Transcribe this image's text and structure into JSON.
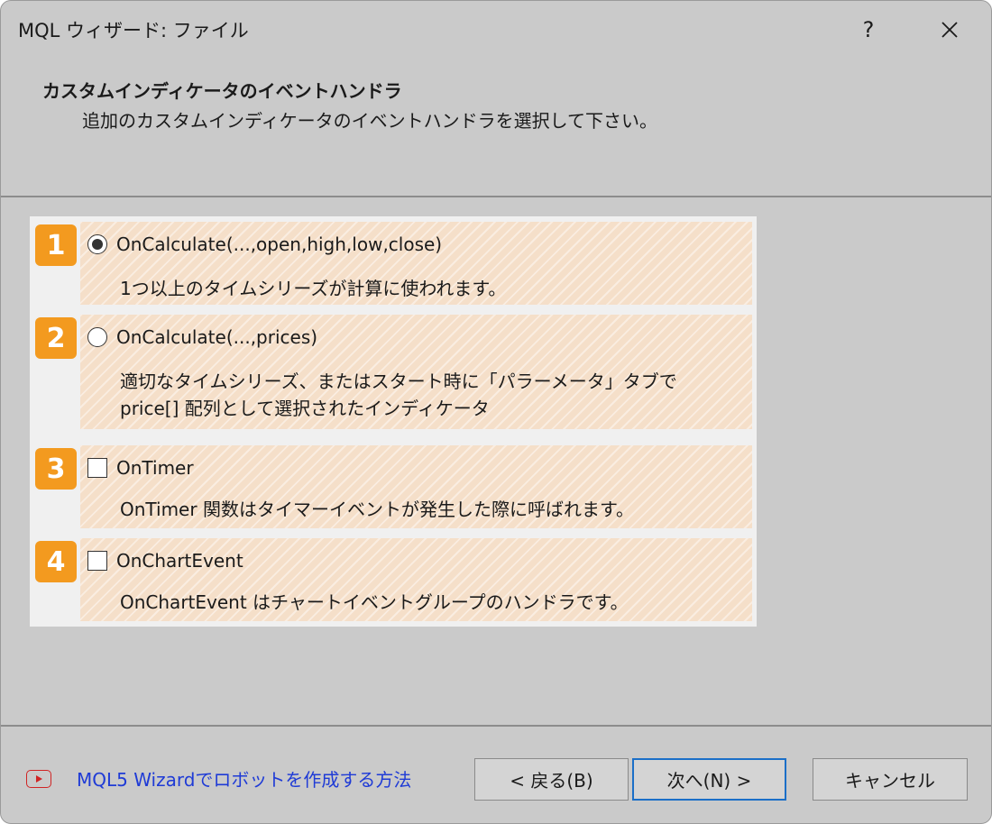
{
  "window": {
    "title": "MQL ウィザード: ファイル",
    "help_label": "?",
    "close_label": "✕"
  },
  "header": {
    "title": "カスタムインディケータのイベントハンドラ",
    "subtitle": "追加のカスタムインディケータのイベントハンドラを選択して下さい。"
  },
  "options": [
    {
      "badge": "1",
      "control": "radio",
      "checked": true,
      "label": "OnCalculate(...,open,high,low,close)",
      "desc": [
        "1つ以上のタイムシリーズが計算に使われます。"
      ]
    },
    {
      "badge": "2",
      "control": "radio",
      "checked": false,
      "label": "OnCalculate(...,prices)",
      "desc": [
        "適切なタイムシリーズ、またはスタート時に「パラーメータ」タブで",
        "price[] 配列として選択されたインディケータ"
      ]
    },
    {
      "badge": "3",
      "control": "checkbox",
      "checked": false,
      "label": "OnTimer",
      "desc": [
        "OnTimer 関数はタイマーイベントが発生した際に呼ばれます。"
      ]
    },
    {
      "badge": "4",
      "control": "checkbox",
      "checked": false,
      "label": "OnChartEvent",
      "desc": [
        "OnChartEvent はチャートイベントグループのハンドラです。"
      ]
    }
  ],
  "footer": {
    "link_icon": "video-play-icon",
    "link_text": "MQL5 Wizardでロボットを作成する方法",
    "back_label": "< 戻る(B)",
    "next_label": "次へ(N) >",
    "cancel_label": "キャンセル"
  },
  "colors": {
    "badge": "#f39a1f",
    "option_bg": "#f5dfc9",
    "link": "#1f3bd6",
    "focus_border": "#1b6fc8",
    "video_icon": "#d02424"
  }
}
